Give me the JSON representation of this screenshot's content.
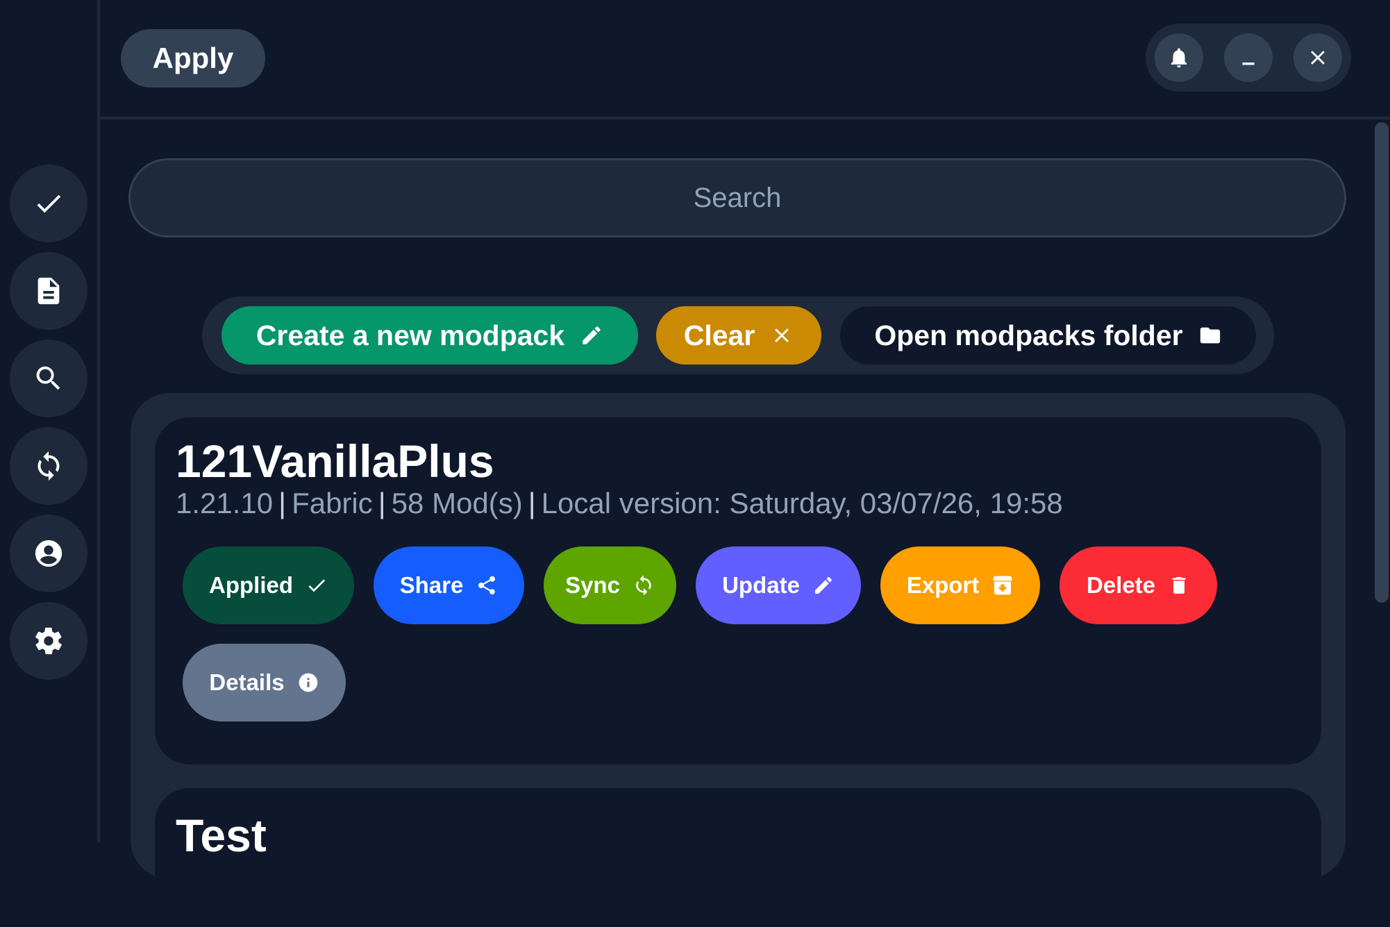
{
  "toolbar": {
    "apply_label": "Apply"
  },
  "window_controls": [
    "bell-icon",
    "minimize-icon",
    "close-icon"
  ],
  "sidebar": {
    "items": [
      {
        "icon": "check-icon"
      },
      {
        "icon": "document-icon"
      },
      {
        "icon": "search-icon"
      },
      {
        "icon": "sync-icon"
      },
      {
        "icon": "account-icon"
      },
      {
        "icon": "gear-icon"
      }
    ]
  },
  "search": {
    "placeholder": "Search",
    "value": ""
  },
  "actions": {
    "create_label": "Create a new modpack",
    "clear_label": "Clear",
    "open_folder_label": "Open modpacks folder"
  },
  "modpacks": [
    {
      "name": "121VanillaPlus",
      "version": "1.21.10",
      "loader": "Fabric",
      "mods": "58 Mod(s)",
      "local_version": "Local version: Saturday, 03/07/26, 19:58",
      "buttons": {
        "applied": "Applied",
        "share": "Share",
        "sync": "Sync",
        "update": "Update",
        "export": "Export",
        "delete": "Delete",
        "details": "Details"
      }
    },
    {
      "name": "Test"
    }
  ],
  "colors": {
    "background": "#0f172a",
    "panel": "#1e293b",
    "create": "#059669",
    "clear": "#ca8a04",
    "applied": "#064e3b",
    "share": "#155dfc",
    "sync": "#5ea500",
    "update": "#615fff",
    "export": "#ff9f00",
    "delete": "#fb2c36",
    "details": "#62748e"
  }
}
